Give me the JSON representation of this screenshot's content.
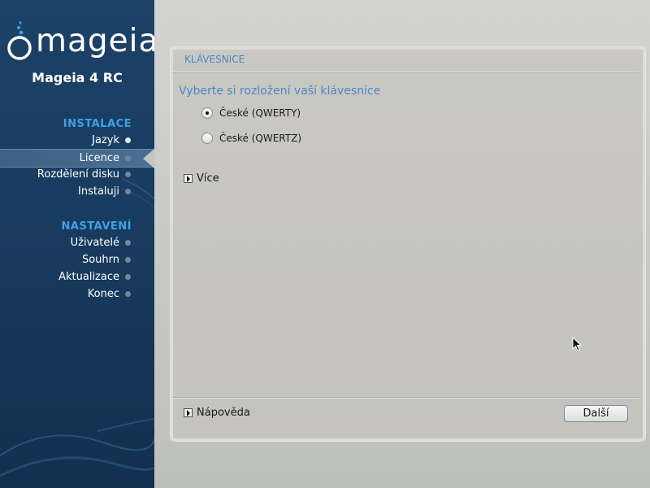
{
  "sidebar": {
    "logo_text": "mageia",
    "version": "Mageia 4 RC",
    "sections": [
      {
        "title": "INSTALACE",
        "steps": [
          {
            "label": "Jazyk",
            "state": "done"
          },
          {
            "label": "Licence",
            "state": "current"
          },
          {
            "label": "Rozdělení disku",
            "state": "pending"
          },
          {
            "label": "Instaluji",
            "state": "pending"
          }
        ]
      },
      {
        "title": "NASTAVENÍ",
        "steps": [
          {
            "label": "Uživatelé",
            "state": "pending"
          },
          {
            "label": "Souhrn",
            "state": "pending"
          },
          {
            "label": "Aktualizace",
            "state": "pending"
          },
          {
            "label": "Konec",
            "state": "pending"
          }
        ]
      }
    ]
  },
  "panel": {
    "title": "KLÁVESNICE",
    "question": "Vyberte si rozložení vaší klávesnice",
    "options": [
      {
        "label": "České (QWERTY)",
        "selected": true
      },
      {
        "label": "České (QWERTZ)",
        "selected": false
      }
    ],
    "more_label": "Více",
    "help_label": "Nápověda",
    "next_label": "Další"
  },
  "colors": {
    "sidebar_bg": "#1d4267",
    "section_title": "#3ea2e6",
    "panel_title": "#4f87c4"
  },
  "icons": {
    "logo": "mageia-logo-icon",
    "expander": "triangle-right-icon",
    "cursor": "mouse-pointer-icon"
  }
}
